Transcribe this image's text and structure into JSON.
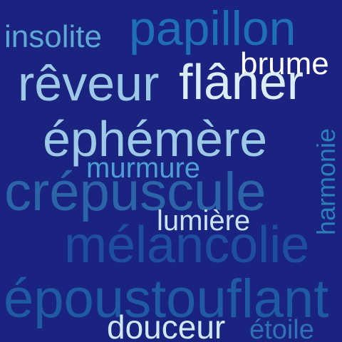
{
  "word_cloud": {
    "words": {
      "insolite": "insolite",
      "papillon": "papillon",
      "brume": "brume",
      "reveur": "rêveur",
      "flaner": "flâner",
      "harmonie": "harmonie",
      "ephemere": "éphémère",
      "murmure": "murmure",
      "crepuscule": "crépuscule",
      "lumiere": "lumière",
      "melancolie": "mélancolie",
      "epoustouflant": "époustouflant",
      "douceur": "douceur",
      "etoile": "étoile"
    },
    "colors": {
      "background": "#1a2480",
      "light": "#9ec9e6",
      "white": "#ffffff",
      "mid_blue": "#2c7fb8",
      "dark_blue": "#1f4ea0"
    }
  }
}
